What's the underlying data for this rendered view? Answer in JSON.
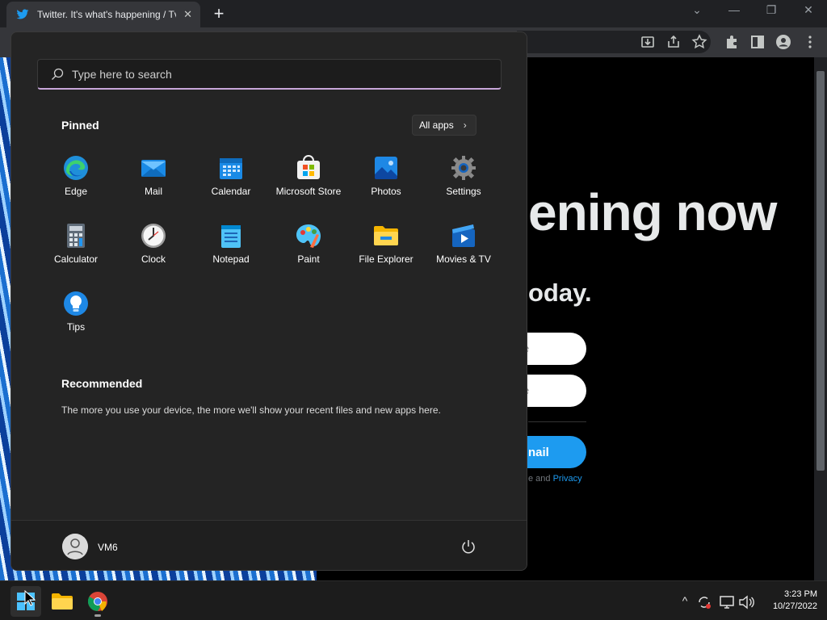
{
  "browser": {
    "tab_title": "Twitter. It's what's happening / Tv",
    "tab_close": "✕",
    "new_tab": "+",
    "win_minimize": "—",
    "win_restore": "❐",
    "win_close": "✕",
    "win_dropdown": "⌄"
  },
  "page": {
    "hero": "ening now",
    "subhead": "oday.",
    "input1_hint": "e",
    "input2_hint": "e",
    "signup_label": "nail",
    "terms_prefix": "e and ",
    "terms_link": "Privacy"
  },
  "start": {
    "search_placeholder": "Type here to search",
    "pinned_title": "Pinned",
    "all_apps_label": "All apps",
    "all_apps_chevron": "›",
    "pinned": [
      {
        "label": "Edge",
        "icon": "edge-icon"
      },
      {
        "label": "Mail",
        "icon": "mail-icon"
      },
      {
        "label": "Calendar",
        "icon": "calendar-icon"
      },
      {
        "label": "Microsoft Store",
        "icon": "store-icon"
      },
      {
        "label": "Photos",
        "icon": "photos-icon"
      },
      {
        "label": "Settings",
        "icon": "settings-icon"
      },
      {
        "label": "Calculator",
        "icon": "calculator-icon"
      },
      {
        "label": "Clock",
        "icon": "clock-icon"
      },
      {
        "label": "Notepad",
        "icon": "notepad-icon"
      },
      {
        "label": "Paint",
        "icon": "paint-icon"
      },
      {
        "label": "File Explorer",
        "icon": "folder-icon"
      },
      {
        "label": "Movies & TV",
        "icon": "movies-icon"
      },
      {
        "label": "Tips",
        "icon": "tips-icon"
      }
    ],
    "recommended_title": "Recommended",
    "recommended_text": "The more you use your device, the more we'll show your recent files and new apps here.",
    "user_name": "VM6"
  },
  "taskbar": {
    "tray_chevron": "^",
    "time": "3:23 PM",
    "date": "10/27/2022"
  },
  "colors": {
    "accent": "#1d9bf0",
    "start_bg": "#242424",
    "search_underline": "#c7a6d9"
  }
}
